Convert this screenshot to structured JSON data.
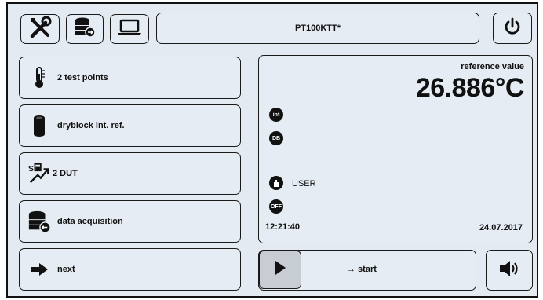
{
  "header": {
    "tools_icon": "tools-icon",
    "database_icon": "database-export-icon",
    "laptop_icon": "laptop-icon",
    "title": "PT100KTT*",
    "power_icon": "power-icon"
  },
  "menu": {
    "items": [
      {
        "icon": "thermometer-icon",
        "label": "2 test points"
      },
      {
        "icon": "dryblock-icon",
        "label": "dryblock int. ref."
      },
      {
        "icon": "dut-icon",
        "label": "2 DUT"
      },
      {
        "icon": "data-acquisition-icon",
        "label": "data acquisition"
      },
      {
        "icon": "arrow-right-icon",
        "label": "next"
      }
    ]
  },
  "reference": {
    "label": "reference value",
    "value": "26.886°C",
    "badges": {
      "int": "int",
      "db": "DB",
      "off": "OFF"
    },
    "user_label": "USER",
    "time": "12:21:40",
    "date": "24.07.2017"
  },
  "controls": {
    "play_icon": "play-icon",
    "start_label": "→ start",
    "speaker_icon": "speaker-icon"
  },
  "colors": {
    "background": "#e4eaf2",
    "button": "#e6ecf3",
    "border": "#1a1a1a",
    "play": "#c8cdd3"
  }
}
